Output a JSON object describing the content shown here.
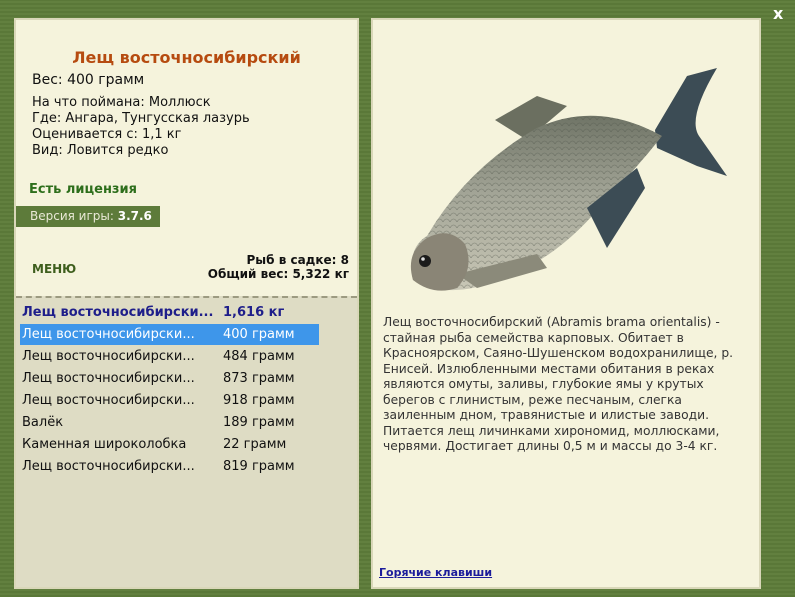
{
  "fish": {
    "title": "Лещ восточносибирский",
    "weight": "Вес: 400 грамм",
    "caught_on": "На что поймана: Моллюск",
    "where": "Где: Ангара, Тунгусская лазурь",
    "valued_from": "Оценивается с: 1,1 кг",
    "kind": "Вид: Ловится редко",
    "license": "Есть лицензия",
    "version_label": "Версия игры:",
    "version_value": "3.7.6"
  },
  "menu_label": "МЕНЮ",
  "stats": {
    "fish_in_cage": "Рыб в садке: 8",
    "total_weight": "Общий вес: 5,322 кг"
  },
  "catch_list": {
    "header": {
      "name": "Лещ восточносибирски...",
      "weight": "1,616 кг"
    },
    "rows": [
      {
        "name": "Лещ восточносибирски...",
        "weight": "400 грамм"
      },
      {
        "name": "Лещ восточносибирски...",
        "weight": "484 грамм"
      },
      {
        "name": "Лещ восточносибирски...",
        "weight": "873 грамм"
      },
      {
        "name": "Лещ восточносибирски...",
        "weight": "918 грамм"
      },
      {
        "name": "Валёк",
        "weight": "189 грамм"
      },
      {
        "name": "Каменная широколобка",
        "weight": "22 грамм"
      },
      {
        "name": "Лещ восточносибирски...",
        "weight": "819 грамм"
      }
    ]
  },
  "description": "Лещ восточносибирский (Abramis brama orientalis) - стайная рыба семейства карповых. Обитает в Красноярском, Саяно-Шушенском водохранилище, р. Енисей. Излюбленными местами обитания в реках являются омуты, заливы, глубокие ямы у крутых берегов с глинистым, реже песчаным, слегка заиленным дном, травянистые и илистые заводи. Питается лещ личинками хирономид, моллюсками, червями. Достигает длины 0,5 м и массы до 3-4 кг.",
  "hotkeys_label": "Горячие клавиши",
  "close_label": "x",
  "colors": {
    "background": "#5d7b3a",
    "panel": "#f5f3dc",
    "title": "#b64b10",
    "license": "#2d6e1b",
    "selected": "#3e96ea"
  }
}
